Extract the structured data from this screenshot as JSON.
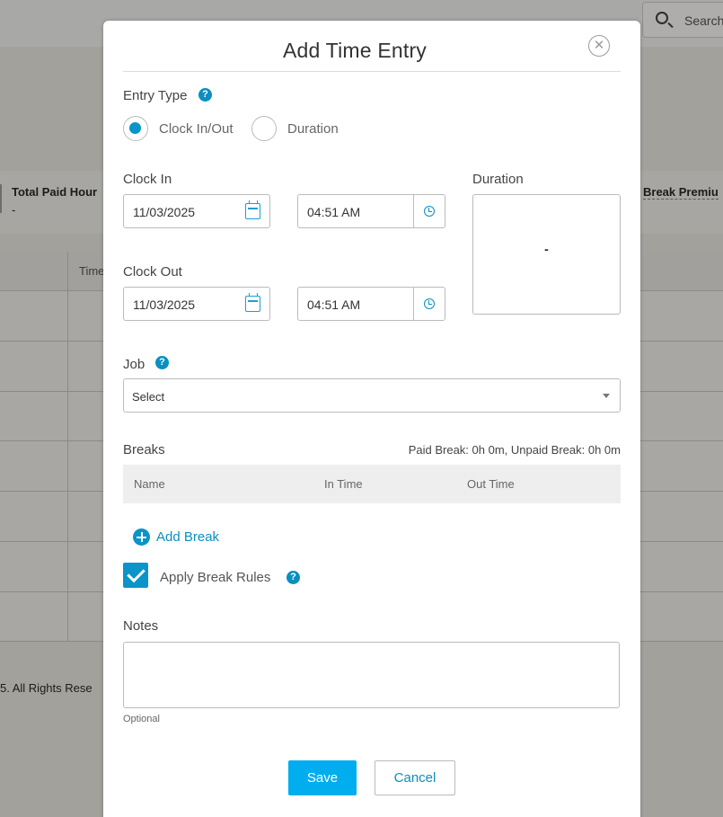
{
  "background": {
    "search_placeholder": "Search",
    "summary_left_label": "Total Paid Hour",
    "summary_left_value": "-",
    "summary_right_label": "Break Premiu",
    "table_header_time": "Time",
    "footer_text": "5. All Rights Rese"
  },
  "modal": {
    "title": "Add Time Entry",
    "entry_type_label": "Entry Type",
    "entry_type_options": [
      "Clock In/Out",
      "Duration"
    ],
    "entry_type_selected": "Clock In/Out",
    "clock_in_label": "Clock In",
    "clock_in_date": "11/03/2025",
    "clock_in_time": "04:51 AM",
    "clock_out_label": "Clock Out",
    "clock_out_date": "11/03/2025",
    "clock_out_time": "04:51 AM",
    "duration_label": "Duration",
    "duration_value": "-",
    "job_label": "Job",
    "job_select_value": "Select",
    "breaks_label": "Breaks",
    "breaks_summary": "Paid Break: 0h 0m, Unpaid Break: 0h 0m",
    "breaks_columns": [
      "Name",
      "In Time",
      "Out Time"
    ],
    "add_break_label": "Add Break",
    "apply_break_rules_label": "Apply Break Rules",
    "apply_break_rules_checked": true,
    "notes_label": "Notes",
    "notes_value": "",
    "notes_hint": "Optional",
    "save_label": "Save",
    "cancel_label": "Cancel"
  },
  "colors": {
    "accent": "#0a94c9",
    "primary_button": "#00aeef"
  }
}
